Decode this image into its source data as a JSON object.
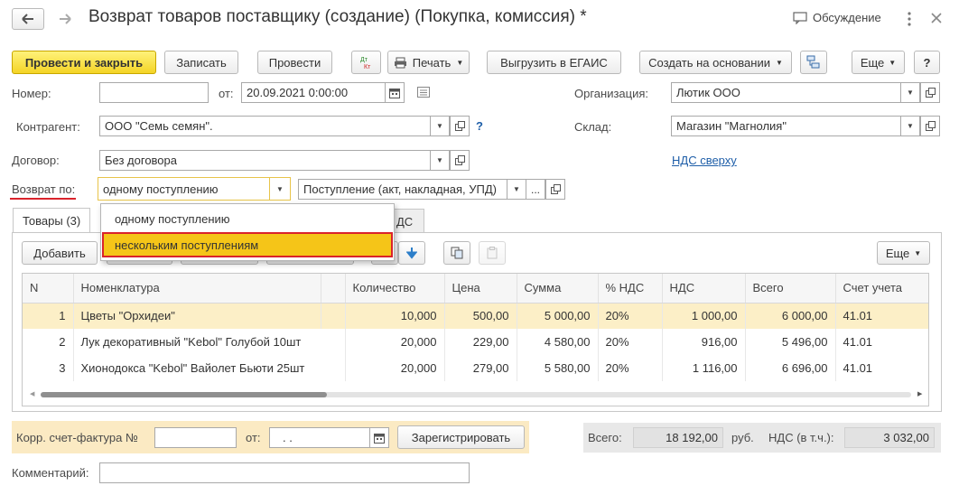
{
  "window": {
    "title": "Возврат товаров поставщику (создание) (Покупка, комиссия) *",
    "discussion_label": "Обсуждение"
  },
  "toolbar": {
    "post_close": "Провести и закрыть",
    "save": "Записать",
    "post": "Провести",
    "print": "Печать",
    "egais": "Выгрузить в ЕГАИС",
    "create_based": "Создать на основании",
    "more": "Еще",
    "help": "?"
  },
  "form": {
    "number_label": "Номер:",
    "number_value": "",
    "from_label": "от:",
    "date_value": "20.09.2021  0:00:00",
    "org_label": "Организация:",
    "org_value": "Лютик ООО",
    "contractor_label": "Контрагент:",
    "contractor_value": "ООО \"Семь семян\".",
    "question": "?",
    "warehouse_label": "Склад:",
    "warehouse_value": "Магазин \"Магнолия\"",
    "contract_label": "Договор:",
    "contract_value": "Без договора",
    "vat_link": "НДС сверху",
    "return_by_label": "Возврат по:",
    "return_by_value": "одному поступлению",
    "receipt_value": "Поступление (акт, накладная, УПД)",
    "ellipsis": "..."
  },
  "dropdown": {
    "options": [
      "одному поступлению",
      "нескольким поступлениям"
    ],
    "highlighted_index": 1
  },
  "tabs": [
    {
      "label": "Товары (3)",
      "active": true
    },
    {
      "label": "ДС",
      "active": false
    }
  ],
  "table_toolbar": {
    "add": "Добавить",
    "more": "Еще"
  },
  "table": {
    "columns": [
      "N",
      "Номенклатура",
      "Количество",
      "Цена",
      "Сумма",
      "% НДС",
      "НДС",
      "Всего",
      "Счет учета"
    ],
    "rows": [
      [
        "1",
        "Цветы \"Орхидеи\"",
        "10,000",
        "500,00",
        "5 000,00",
        "20%",
        "1 000,00",
        "6 000,00",
        "41.01"
      ],
      [
        "2",
        "Лук декоративный \"Kebol\" Голубой 10шт",
        "20,000",
        "229,00",
        "4 580,00",
        "20%",
        "916,00",
        "5 496,00",
        "41.01"
      ],
      [
        "3",
        "Хионодокса \"Kebol\" Вайолет Бьюти 25шт",
        "20,000",
        "279,00",
        "5 580,00",
        "20%",
        "1 116,00",
        "6 696,00",
        "41.01"
      ]
    ]
  },
  "footer": {
    "corr_invoice_label": "Корр. счет-фактура №",
    "corr_invoice_value": "",
    "from_label": "от:",
    "date_placeholder": ".  .",
    "register": "Зарегистрировать",
    "total_label": "Всего:",
    "total_value": "18 192,00",
    "currency": "руб.",
    "vat_label": "НДС (в т.ч.):",
    "vat_value": "3 032,00",
    "comment_label": "Комментарий:",
    "comment_value": ""
  },
  "colors": {
    "accent_yellow": "#f4d426",
    "highlight_red": "#d9232b",
    "selected_row": "#fcefc7",
    "link_blue": "#1e5ea8",
    "footer_bg": "#fbeac3",
    "totals_bg": "#e8e8e8"
  }
}
